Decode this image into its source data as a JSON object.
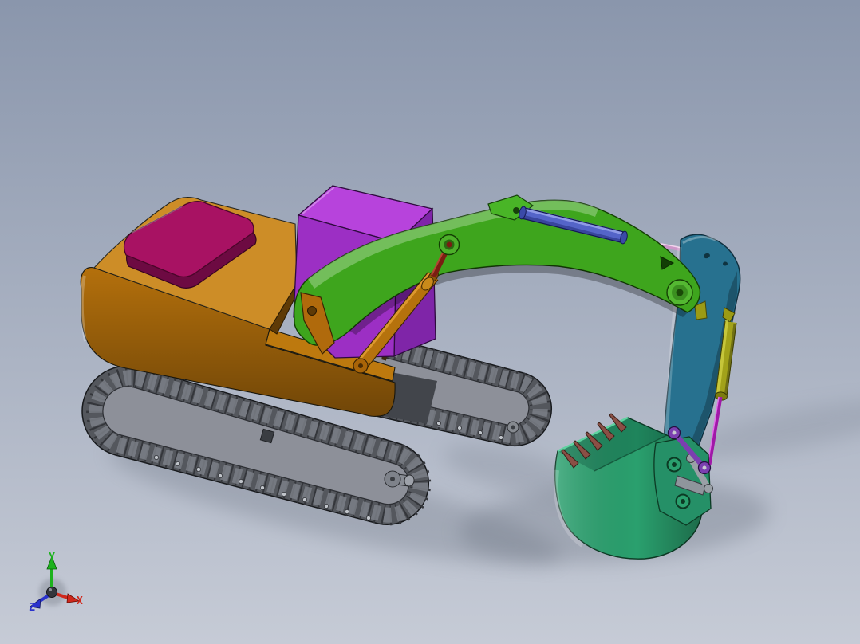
{
  "viewport": {
    "description": "3D CAD viewport with excavator assembly model",
    "background_top": "#8a96ac",
    "background_bottom": "#c6cbd6",
    "shadow_color": "#68707e"
  },
  "triad": {
    "axes": [
      {
        "label": "X",
        "color": "#d0281c"
      },
      {
        "label": "Y",
        "color": "#1db21d"
      },
      {
        "label": "Z",
        "color": "#2a32cc"
      }
    ]
  },
  "model": {
    "name": "excavator assembly",
    "parts": {
      "house": {
        "label": "house upper frame",
        "color": "#b4700c"
      },
      "house_top": {
        "label": "house top deck",
        "color": "#c8810f"
      },
      "engine_cover": {
        "label": "engine cover",
        "color": "#a81263"
      },
      "engine_side": {
        "label": "engine cover side",
        "color": "#6d0a42"
      },
      "cab": {
        "label": "cab",
        "color": "#9c2fc4"
      },
      "cab_top": {
        "label": "cab roof",
        "color": "#b743dc"
      },
      "cab_side": {
        "label": "cab side",
        "color": "#7f25a8"
      },
      "boom": {
        "label": "boom",
        "color": "#3ea51d"
      },
      "boom_bracket": {
        "label": "boom cylinder bracket",
        "color": "#49b527"
      },
      "boom_cylinder": {
        "label": "boom cylinder",
        "color": "#b5720d"
      },
      "boom_rod": {
        "label": "boom cylinder rod",
        "color": "#7a1d12"
      },
      "stick_cylinder": {
        "label": "stick cylinder",
        "color": "#5464c8"
      },
      "stick_rod": {
        "label": "stick cylinder rod",
        "color": "#cc96c8"
      },
      "stick": {
        "label": "stick arm",
        "color": "#27718f"
      },
      "bucket_cylinder": {
        "label": "bucket cylinder",
        "color": "#a2a21a"
      },
      "bucket_rod": {
        "label": "bucket cylinder rod",
        "color": "#a018a8"
      },
      "bucket_link": {
        "label": "bucket link",
        "color": "#7b3fb0"
      },
      "idler_link": {
        "label": "idler link",
        "color": "#9aa0a6"
      },
      "bucket": {
        "label": "bucket",
        "color": "#2aa06e"
      },
      "bucket_bracket": {
        "label": "bucket bracket",
        "color": "#259067"
      },
      "teeth": {
        "label": "bucket teeth",
        "color": "#8a4f45"
      },
      "track_frame": {
        "label": "track frame",
        "color": "#8d9099"
      },
      "track_tread": {
        "label": "track tread",
        "color": "#54575d"
      }
    }
  }
}
